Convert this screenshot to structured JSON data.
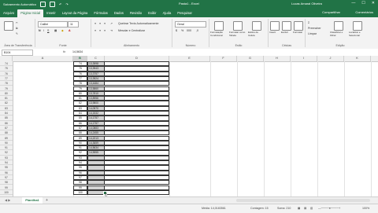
{
  "window": {
    "autosave_label": "Salvamento Automático",
    "title": "Pasta1 - Excel",
    "user": "Lucas Amaral Oliveira",
    "minimize": "—",
    "maximize": "☐",
    "close": "✕"
  },
  "tabs": [
    "Arquivo",
    "Página Inicial",
    "Inserir",
    "Layout da Página",
    "Fórmulas",
    "Dados",
    "Revisão",
    "Exibir",
    "Ajuda",
    "Pesquisar"
  ],
  "active_tab": "Página Inicial",
  "share_label": "Compartilhar",
  "comments_label": "Comentários",
  "ribbon": {
    "clipboard_label": "Área de Transferência",
    "font_name": "Calibri",
    "font_size": "11",
    "font_label": "Fonte",
    "wrap_text": "Quebrar Texto Automaticamente",
    "merge_center": "Mesclar e Centralizar",
    "alignment_label": "Alinhamento",
    "number_format": "Geral",
    "number_label": "Número",
    "conditional_format": "Formatação Condicional",
    "format_as_table": "Formatar como Tabela",
    "cell_styles": "Estilos de Célula",
    "styles_label": "Estilo",
    "insert": "Inserir",
    "delete": "Excluir",
    "format": "Formatar",
    "cells_label": "Células",
    "sum": "Σ",
    "fill": "Preencher",
    "clear": "Limpar",
    "sort_filter": "Classificar e Filtrar",
    "find_select": "Localizar e Selecionar",
    "editing_label": "Edição"
  },
  "formula_bar": {
    "name_box": "B104",
    "fx": "fx",
    "value": "14,5634"
  },
  "columns": [
    "A",
    "B",
    "C",
    "D",
    "E",
    "F",
    "G",
    "H",
    "I",
    "J",
    "K",
    "L",
    "M",
    "N"
  ],
  "rows": [
    {
      "num": "74",
      "a": "74",
      "b": "13,3598"
    },
    {
      "num": "75",
      "a": "75",
      "b": "13,3943"
    },
    {
      "num": "76",
      "a": "76",
      "b": "13,3757"
    },
    {
      "num": "77",
      "a": "77",
      "b": "13,3924"
    },
    {
      "num": "78",
      "a": "78",
      "b": "13,4484"
    },
    {
      "num": "79",
      "a": "79",
      "b": "13,5860"
    },
    {
      "num": "80",
      "a": "80",
      "b": "13,7810"
    },
    {
      "num": "81",
      "a": "81",
      "b": "13,8956"
    },
    {
      "num": "82",
      "a": "82",
      "b": "13,9800"
    },
    {
      "num": "83",
      "a": "83",
      "b": "14,0570"
    },
    {
      "num": "84",
      "a": "84",
      "b": "14,1532"
    },
    {
      "num": "85",
      "a": "85",
      "b": "14,1757"
    },
    {
      "num": "86",
      "a": "86",
      "b": "14,1757"
    },
    {
      "num": "87",
      "a": "87",
      "b": "14,0883"
    },
    {
      "num": "88",
      "a": "88",
      "b": "14,2455"
    },
    {
      "num": "89",
      "a": "89",
      "b": "14,2213"
    },
    {
      "num": "90",
      "a": "90",
      "b": "14,3659"
    },
    {
      "num": "91",
      "a": "91",
      "b": "14,5634"
    },
    {
      "num": "92",
      "a": "92",
      "b": "14,5555"
    },
    {
      "num": "93",
      "a": "93",
      "b": ""
    },
    {
      "num": "94",
      "a": "94",
      "b": ""
    },
    {
      "num": "95",
      "a": "95",
      "b": ""
    },
    {
      "num": "96",
      "a": "96",
      "b": ""
    },
    {
      "num": "97",
      "a": "97",
      "b": ""
    },
    {
      "num": "98",
      "a": "98",
      "b": ""
    },
    {
      "num": "99",
      "a": "99",
      "b": ""
    },
    {
      "num": "100",
      "a": "100",
      "b": ""
    }
  ],
  "sheet_tab": "Planilha1",
  "new_sheet": "+",
  "status": {
    "average": "Média: 14,0183561",
    "count": "Contagem: 15",
    "sum": "Soma: 210",
    "zoom": "100%"
  }
}
